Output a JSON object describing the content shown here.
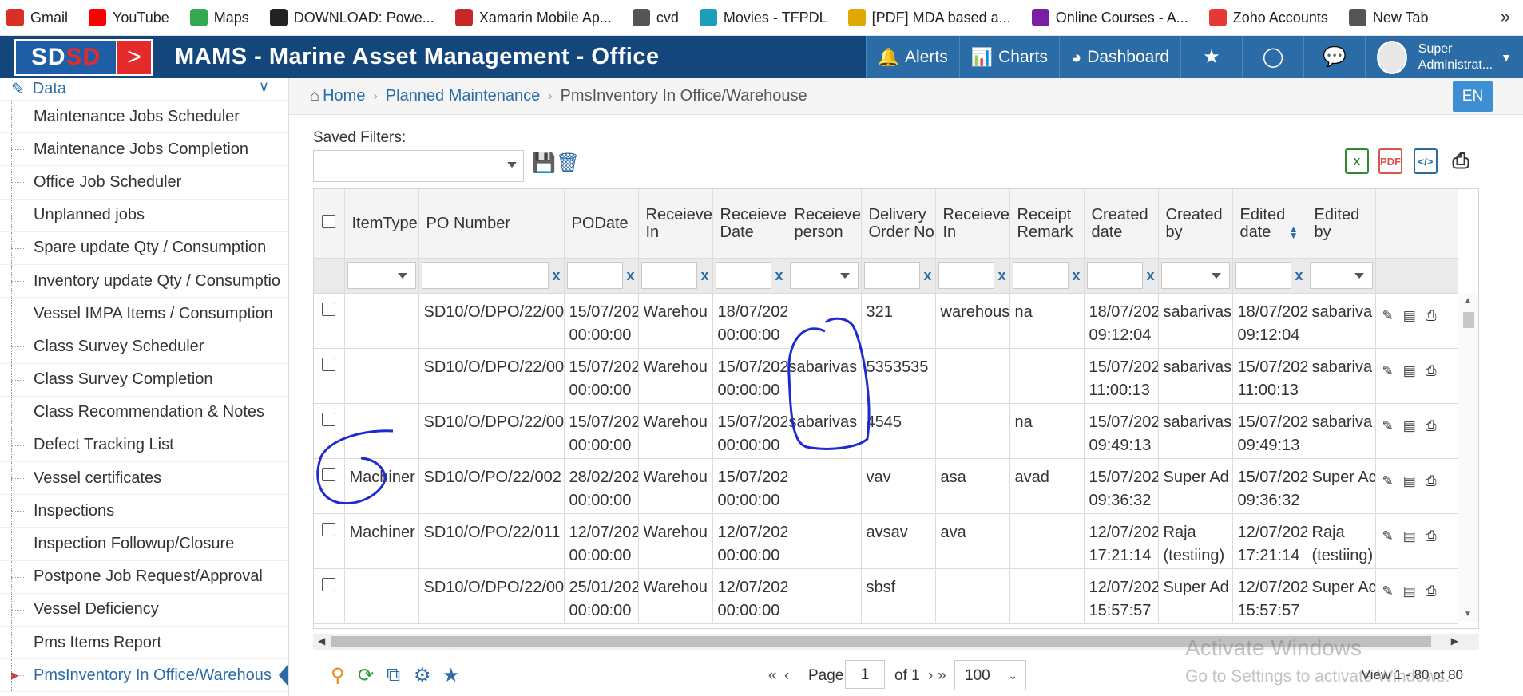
{
  "bookmarks": [
    {
      "label": "Gmail",
      "icon": "gmail-icon",
      "color": "#d93025"
    },
    {
      "label": "YouTube",
      "icon": "youtube-icon",
      "color": "#ff0000"
    },
    {
      "label": "Maps",
      "icon": "maps-icon",
      "color": "#34a853"
    },
    {
      "label": "DOWNLOAD: Powe...",
      "icon": "download-icon",
      "color": "#222222"
    },
    {
      "label": "Xamarin Mobile Ap...",
      "icon": "pd-icon",
      "color": "#c62828"
    },
    {
      "label": "cvd",
      "icon": "globe-icon",
      "color": "#555555"
    },
    {
      "label": "Movies - TFPDL",
      "icon": "tfpdl-icon",
      "color": "#19a0b8"
    },
    {
      "label": "[PDF] MDA based a...",
      "icon": "pdf-icon",
      "color": "#e0a800"
    },
    {
      "label": "Online Courses - A...",
      "icon": "udemy-icon",
      "color": "#7b1fa2"
    },
    {
      "label": "Zoho Accounts",
      "icon": "zoho-icon",
      "color": "#e53935"
    },
    {
      "label": "New Tab",
      "icon": "globe-icon",
      "color": "#555555"
    }
  ],
  "header": {
    "logo_left": "SD",
    "logo_red": "SD",
    "logo_arrow": ">",
    "title": "MAMS - Marine Asset Management - Office",
    "nav": {
      "alerts": "Alerts",
      "charts": "Charts",
      "dashboard": "Dashboard"
    },
    "user": {
      "line1": "Super",
      "line2": "Administrat..."
    }
  },
  "sidebar": {
    "section": "Data",
    "items": [
      "Maintenance Jobs Scheduler",
      "Maintenance Jobs Completion",
      "Office Job Scheduler",
      "Unplanned jobs",
      "Spare update Qty / Consumption",
      "Inventory update Qty / Consumptio",
      "Vessel IMPA Items / Consumption",
      "Class Survey Scheduler",
      "Class Survey Completion",
      "Class Recommendation & Notes",
      "Defect Tracking List",
      "Vessel certificates",
      "Inspections",
      "Inspection Followup/Closure",
      "Postpone Job Request/Approval",
      "Vessel Deficiency",
      "Pms Items Report"
    ],
    "active": "PmsInventory In Office/Warehous"
  },
  "breadcrumb": {
    "home": "Home",
    "parent": "Planned Maintenance",
    "current": "PmsInventory In Office/Warehouse",
    "lang": "EN"
  },
  "filters": {
    "saved_label": "Saved Filters:"
  },
  "grid": {
    "columns": [
      "ItemType",
      "PO Number",
      "PODate",
      "Receieve In",
      "Receieve Date",
      "Receieve person",
      "Delivery Order No",
      "Receieve In",
      "Receipt Remark",
      "Created date",
      "Created by",
      "Edited date",
      "Edited by"
    ],
    "clear": "x",
    "rows": [
      {
        "itemtype": "",
        "po": "SD10/O/DPO/22/00",
        "podate1": "15/07/202",
        "podate2": "00:00:00",
        "recin": "Warehou",
        "recdate1": "18/07/202",
        "recdate2": "00:00:00",
        "person": "",
        "dono": "321",
        "recin2": "warehous",
        "remark": "na",
        "cdate1": "18/07/202",
        "cdate2": "09:12:04",
        "cby": "sabarivas",
        "edate1": "18/07/202",
        "edate2": "09:12:04",
        "eby": "sabariva"
      },
      {
        "itemtype": "",
        "po": "SD10/O/DPO/22/00",
        "podate1": "15/07/202",
        "podate2": "00:00:00",
        "recin": "Warehou",
        "recdate1": "15/07/202",
        "recdate2": "00:00:00",
        "person": "sabarivas",
        "dono": "5353535",
        "recin2": "",
        "remark": "",
        "cdate1": "15/07/202",
        "cdate2": "11:00:13",
        "cby": "sabarivas",
        "edate1": "15/07/202",
        "edate2": "11:00:13",
        "eby": "sabariva"
      },
      {
        "itemtype": "",
        "po": "SD10/O/DPO/22/00",
        "podate1": "15/07/202",
        "podate2": "00:00:00",
        "recin": "Warehou",
        "recdate1": "15/07/202",
        "recdate2": "00:00:00",
        "person": "sabarivas",
        "dono": "4545",
        "recin2": "",
        "remark": "na",
        "cdate1": "15/07/202",
        "cdate2": "09:49:13",
        "cby": "sabarivas",
        "edate1": "15/07/202",
        "edate2": "09:49:13",
        "eby": "sabariva"
      },
      {
        "itemtype": "Machiner",
        "po": "SD10/O/PO/22/002",
        "podate1": "28/02/202",
        "podate2": "00:00:00",
        "recin": "Warehou",
        "recdate1": "15/07/202",
        "recdate2": "00:00:00",
        "person": "",
        "dono": "vav",
        "recin2": "asa",
        "remark": "avad",
        "cdate1": "15/07/202",
        "cdate2": "09:36:32",
        "cby": "Super Ad",
        "edate1": "15/07/202",
        "edate2": "09:36:32",
        "eby": "Super Ac"
      },
      {
        "itemtype": "Machiner",
        "po": "SD10/O/PO/22/011",
        "podate1": "12/07/202",
        "podate2": "00:00:00",
        "recin": "Warehou",
        "recdate1": "12/07/202",
        "recdate2": "00:00:00",
        "person": "",
        "dono": "avsav",
        "recin2": "ava",
        "remark": "",
        "cdate1": "12/07/202",
        "cdate2": "17:21:14",
        "cby": "Raja",
        "cby2": "(testiing)",
        "edate1": "12/07/202",
        "edate2": "17:21:14",
        "eby": "Raja",
        "eby2": "(testiing)"
      },
      {
        "itemtype": "",
        "po": "SD10/O/DPO/22/00",
        "podate1": "25/01/202",
        "podate2": "00:00:00",
        "recin": "Warehou",
        "recdate1": "12/07/202",
        "recdate2": "00:00:00",
        "person": "",
        "dono": "sbsf",
        "recin2": "",
        "remark": "",
        "cdate1": "12/07/202",
        "cdate2": "15:57:57",
        "cby": "Super Ad",
        "edate1": "12/07/202",
        "edate2": "15:57:57",
        "eby": "Super Ac"
      }
    ]
  },
  "pager": {
    "page_label": "Page",
    "page_value": "1",
    "of_label": "of 1",
    "size": "100",
    "view": "View 1 - 80 of 80"
  },
  "watermark": {
    "line1": "Activate Windows",
    "line2": "Go to Settings to activate Windows."
  },
  "colors": {
    "header": "#13477c",
    "nav": "#2b6ca6",
    "link": "#2b6ca6",
    "logo_red": "#e52a2c",
    "annotation": "#1f2ad1"
  }
}
